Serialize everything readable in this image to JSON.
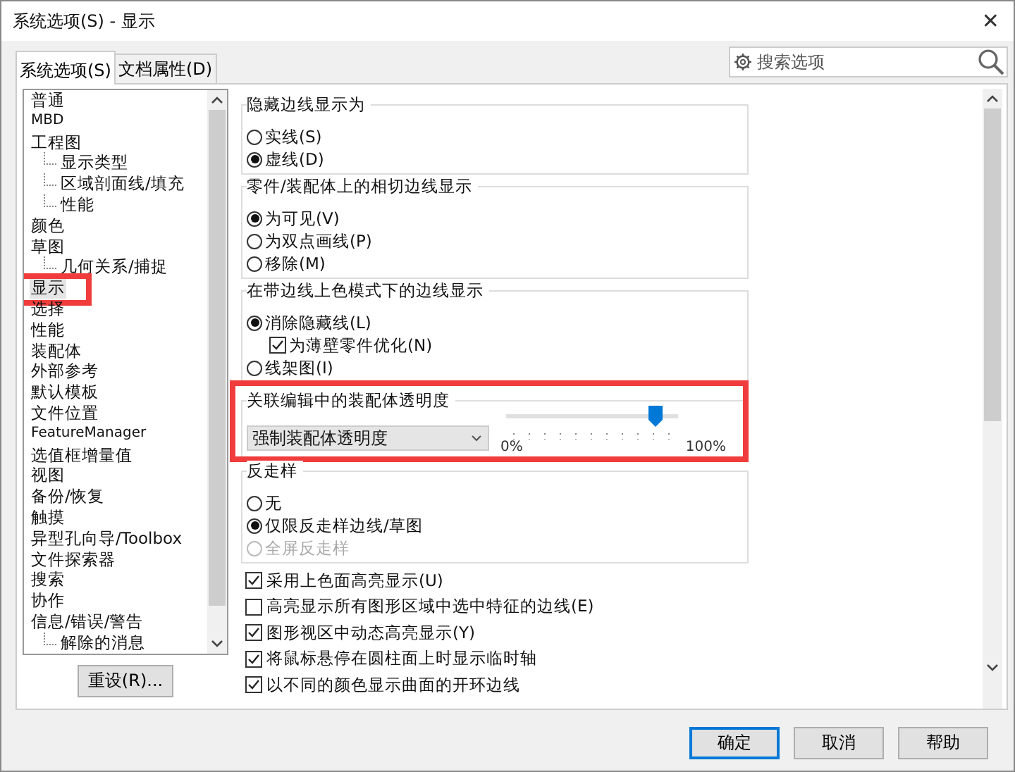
{
  "window": {
    "title": "系统选项(S) - 显示",
    "close": "✕"
  },
  "tabs": [
    {
      "label": "系统选项(S)",
      "selected": true
    },
    {
      "label": "文档属性(D)",
      "selected": false
    }
  ],
  "search": {
    "placeholder": "搜索选项"
  },
  "tree": [
    {
      "label": "普通",
      "selected": false,
      "marked": false
    },
    {
      "label": "MBD",
      "selected": false,
      "marked": false
    },
    {
      "label": "工程图",
      "selected": false,
      "marked": false,
      "children": [
        {
          "label": "显示类型",
          "selected": false,
          "marked": false
        },
        {
          "label": "区域剖面线/填充",
          "selected": false,
          "marked": false
        },
        {
          "label": "性能",
          "selected": false,
          "marked": false
        }
      ]
    },
    {
      "label": "颜色",
      "selected": false,
      "marked": false
    },
    {
      "label": "草图",
      "selected": false,
      "marked": false,
      "children": [
        {
          "label": "几何关系/捕捉",
          "selected": false,
          "marked": false
        }
      ]
    },
    {
      "label": "显示",
      "selected": true,
      "marked": true
    },
    {
      "label": "选择",
      "selected": false,
      "marked": false
    },
    {
      "label": "性能",
      "selected": false,
      "marked": false
    },
    {
      "label": "装配体",
      "selected": false,
      "marked": false
    },
    {
      "label": "外部参考",
      "selected": false,
      "marked": false
    },
    {
      "label": "默认模板",
      "selected": false,
      "marked": false
    },
    {
      "label": "文件位置",
      "selected": false,
      "marked": false
    },
    {
      "label": "FeatureManager",
      "selected": false,
      "marked": false
    },
    {
      "label": "选值框增量值",
      "selected": false,
      "marked": false
    },
    {
      "label": "视图",
      "selected": false,
      "marked": false
    },
    {
      "label": "备份/恢复",
      "selected": false,
      "marked": false
    },
    {
      "label": "触摸",
      "selected": false,
      "marked": false
    },
    {
      "label": "异型孔向导/Toolbox",
      "selected": false,
      "marked": false
    },
    {
      "label": "文件探索器",
      "selected": false,
      "marked": false
    },
    {
      "label": "搜索",
      "selected": false,
      "marked": false
    },
    {
      "label": "协作",
      "selected": false,
      "marked": false
    },
    {
      "label": "信息/错误/警告",
      "selected": false,
      "marked": false,
      "children": [
        {
          "label": "解除的消息",
          "selected": false,
          "marked": false
        }
      ]
    }
  ],
  "reset_button": "重设(R)...",
  "sections": [
    {
      "kind": "group",
      "title": "隐藏边线显示为",
      "marked": false,
      "options": [
        {
          "kind": "radio",
          "label": "实线(S)",
          "selected": false,
          "disabled": false
        },
        {
          "kind": "radio",
          "label": "虚线(D)",
          "selected": true,
          "disabled": false
        }
      ]
    },
    {
      "kind": "group",
      "title": "零件/装配体上的相切边线显示",
      "marked": false,
      "options": [
        {
          "kind": "radio",
          "label": "为可见(V)",
          "selected": true,
          "disabled": false
        },
        {
          "kind": "radio",
          "label": "为双点画线(P)",
          "selected": false,
          "disabled": false
        },
        {
          "kind": "radio",
          "label": "移除(M)",
          "selected": false,
          "disabled": false
        }
      ]
    },
    {
      "kind": "group",
      "title": "在带边线上色模式下的边线显示",
      "marked": false,
      "options": [
        {
          "kind": "radio",
          "label": "消除隐藏线(L)",
          "selected": true,
          "disabled": false,
          "children": [
            {
              "kind": "checkbox",
              "label": "为薄壁零件优化(N)",
              "checked": true,
              "disabled": false
            }
          ]
        },
        {
          "kind": "radio",
          "label": "线架图(I)",
          "selected": false,
          "disabled": false
        }
      ]
    },
    {
      "kind": "transparency",
      "title": "关联编辑中的装配体透明度",
      "marked": true,
      "dropdown": "强制装配体透明度",
      "level": 0.87,
      "min_label": "0%",
      "max_label": "100%"
    },
    {
      "kind": "group",
      "title": "反走样",
      "marked": false,
      "options": [
        {
          "kind": "radio",
          "label": "无",
          "selected": false,
          "disabled": false
        },
        {
          "kind": "radio",
          "label": "仅限反走样边线/草图",
          "selected": true,
          "disabled": false
        },
        {
          "kind": "radio",
          "label": "全屏反走样",
          "selected": false,
          "disabled": true
        }
      ]
    },
    {
      "kind": "checkbox",
      "label": "采用上色面高亮显示(U)",
      "checked": true,
      "disabled": false
    },
    {
      "kind": "checkbox",
      "label": "高亮显示所有图形区域中选中特征的边线(E)",
      "checked": false,
      "disabled": false
    },
    {
      "kind": "checkbox",
      "label": "图形视区中动态高亮显示(Y)",
      "checked": true,
      "disabled": false
    },
    {
      "kind": "checkbox",
      "label": "将鼠标悬停在圆柱面上时显示临时轴",
      "checked": true,
      "disabled": false
    },
    {
      "kind": "checkbox",
      "label": "以不同的颜色显示曲面的开环边线",
      "checked": true,
      "disabled": false
    }
  ],
  "buttons": [
    {
      "label": "确定",
      "default": true
    },
    {
      "label": "取消",
      "default": false
    },
    {
      "label": "帮助",
      "default": false
    }
  ]
}
